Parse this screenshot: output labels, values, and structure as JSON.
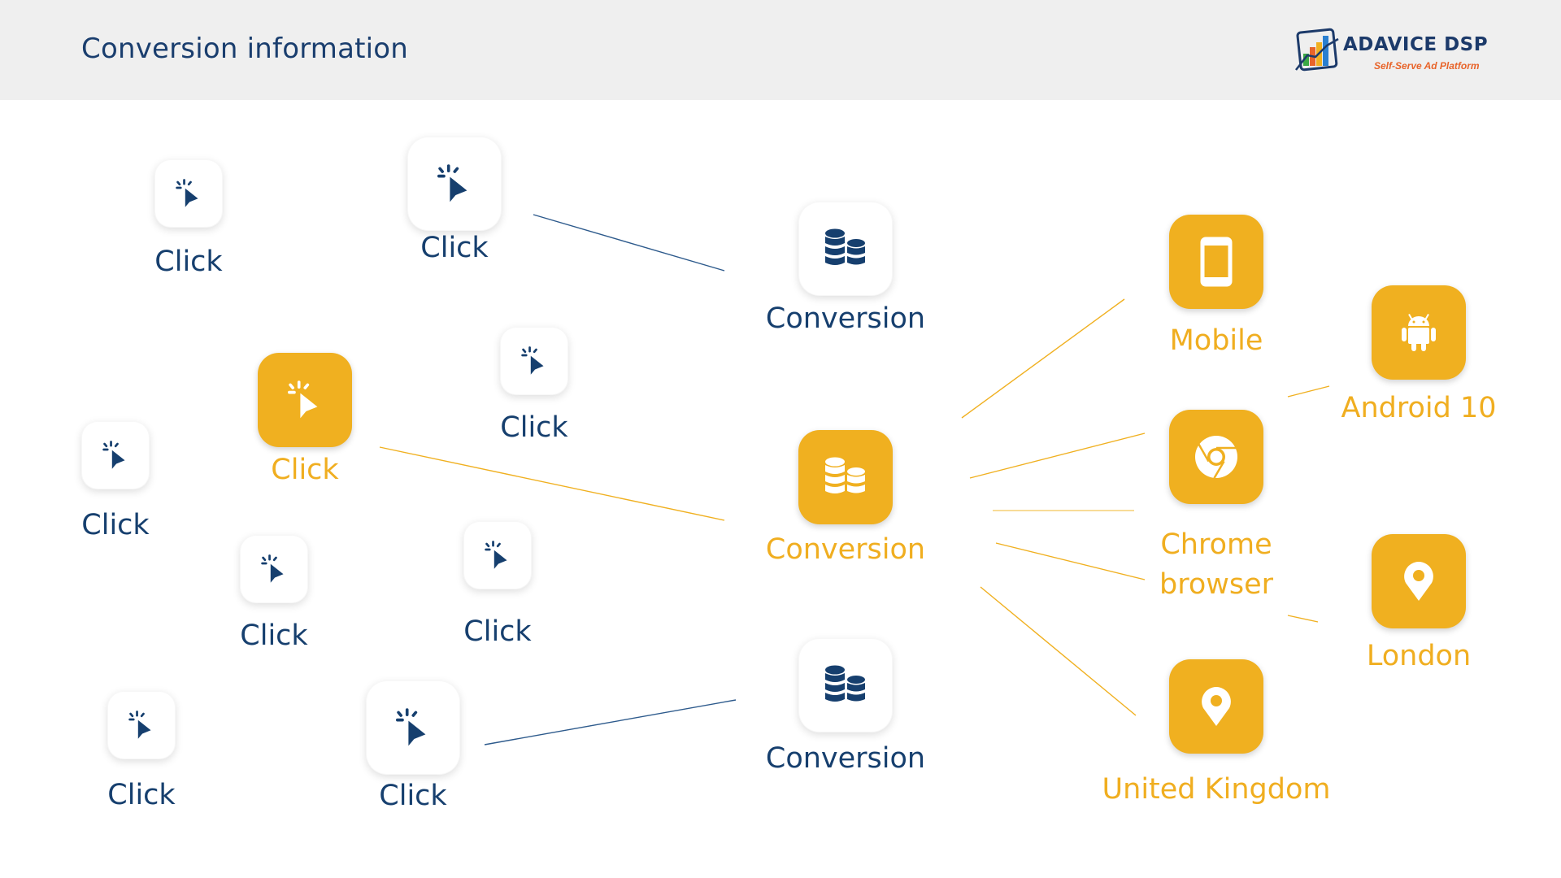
{
  "header": {
    "title": "Conversion information",
    "logo": {
      "name": "ADAVICE DSP",
      "tagline": "Self-Serve Ad Platform"
    }
  },
  "colors": {
    "navy": "#163f6e",
    "gold": "#f0b020",
    "header_bg": "#efefef"
  },
  "clicks": [
    {
      "label": "Click",
      "icon": "cursor-click-icon",
      "highlighted": false
    },
    {
      "label": "Click",
      "icon": "cursor-click-icon",
      "highlighted": false
    },
    {
      "label": "Click",
      "icon": "cursor-click-icon",
      "highlighted": true
    },
    {
      "label": "Click",
      "icon": "cursor-click-icon",
      "highlighted": false
    },
    {
      "label": "Click",
      "icon": "cursor-click-icon",
      "highlighted": false
    },
    {
      "label": "Click",
      "icon": "cursor-click-icon",
      "highlighted": false
    },
    {
      "label": "Click",
      "icon": "cursor-click-icon",
      "highlighted": false
    },
    {
      "label": "Click",
      "icon": "cursor-click-icon",
      "highlighted": false
    },
    {
      "label": "Click",
      "icon": "cursor-click-icon",
      "highlighted": false
    }
  ],
  "conversions": [
    {
      "label": "Conversion",
      "icon": "coins-stack-icon",
      "highlighted": false
    },
    {
      "label": "Conversion",
      "icon": "coins-stack-icon",
      "highlighted": true
    },
    {
      "label": "Conversion",
      "icon": "coins-stack-icon",
      "highlighted": false
    }
  ],
  "attributes": [
    {
      "label": "Mobile",
      "icon": "mobile-phone-icon"
    },
    {
      "label": "Android 10",
      "icon": "android-icon"
    },
    {
      "label": "Chrome browser",
      "line1": "Chrome",
      "line2": "browser",
      "icon": "chrome-icon"
    },
    {
      "label": "London",
      "icon": "map-pin-icon"
    },
    {
      "label": "United Kingdom",
      "icon": "map-pin-icon"
    }
  ],
  "connections": [
    {
      "from": "click-2",
      "to": "conversion-1"
    },
    {
      "from": "click-3",
      "to": "conversion-2"
    },
    {
      "from": "click-9",
      "to": "conversion-3"
    },
    {
      "from": "conversion-2",
      "to": "mobile"
    },
    {
      "from": "conversion-2",
      "to": "chrome-browser"
    },
    {
      "from": "conversion-2",
      "to": "chrome-browser"
    },
    {
      "from": "conversion-2",
      "to": "chrome-browser"
    },
    {
      "from": "conversion-2",
      "to": "united-kingdom"
    },
    {
      "from": "mobile",
      "to": "android-10"
    },
    {
      "from": "chrome-browser",
      "to": "london"
    }
  ]
}
